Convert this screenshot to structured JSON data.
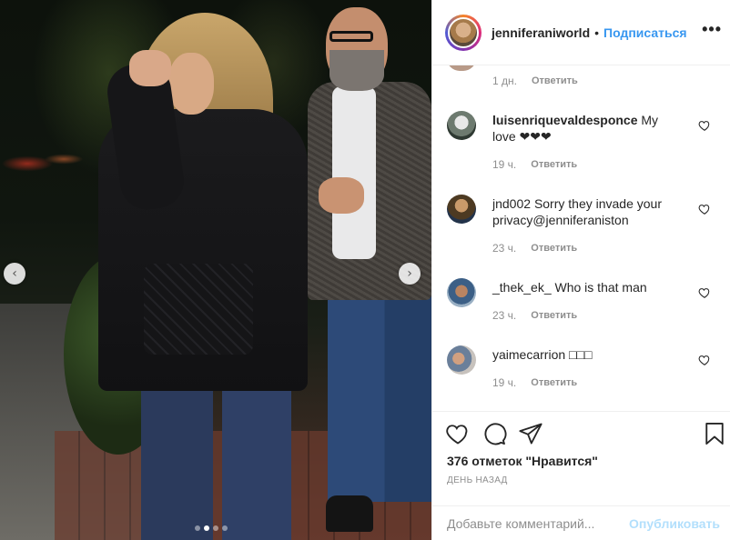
{
  "header": {
    "username": "jenniferaniworld",
    "separator": "•",
    "follow_label": "Подписаться",
    "more_icon": "more-dots-icon"
  },
  "carousel": {
    "image_count": 4,
    "active_index": 1,
    "prev_icon": "chevron-left-icon",
    "next_icon": "chevron-right-icon",
    "prev_glyph": "‹",
    "next_glyph": "›"
  },
  "comments": {
    "partial": {
      "time": "1 дн.",
      "reply_label": "Ответить"
    },
    "items": [
      {
        "username": "luisenriquevaldesponce",
        "text": "My love ❤❤❤",
        "time": "19 ч.",
        "reply_label": "Ответить"
      },
      {
        "username": "jnd002",
        "text": "Sorry they invade your privacy@jenniferaniston",
        "time": "23 ч.",
        "reply_label": "Ответить"
      },
      {
        "username": "_thek_ek_",
        "text": "Who is that man",
        "time": "23 ч.",
        "reply_label": "Ответить"
      },
      {
        "username": "yaimecarrion",
        "text": "□□□",
        "time": "19 ч.",
        "reply_label": "Ответить"
      }
    ]
  },
  "actions": {
    "like_icon": "heart-icon",
    "comment_icon": "comment-icon",
    "share_icon": "share-icon",
    "save_icon": "bookmark-icon",
    "likes_text": "376 отметок \"Нравится\"",
    "posted_text": "день назад"
  },
  "add_comment": {
    "placeholder": "Добавьте комментарий...",
    "publish_label": "Опубликовать"
  },
  "colors": {
    "accent": "#3897f0",
    "publish_disabled": "#b2dffc",
    "muted": "#8e8e8e"
  }
}
